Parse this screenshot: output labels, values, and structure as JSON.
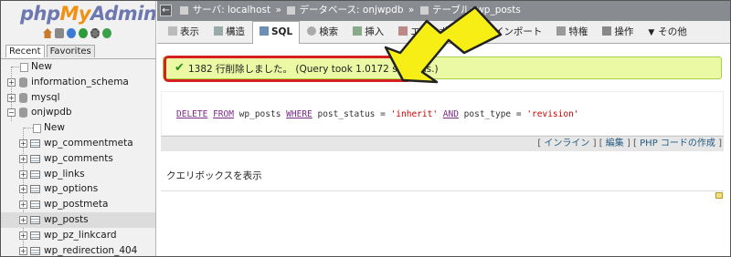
{
  "logo": {
    "php": "php",
    "my": "My",
    "admin": "Admin"
  },
  "quick_icons": [
    "home-icon",
    "exit-icon",
    "docs-icon",
    "help-icon",
    "settings-icon",
    "reload-icon"
  ],
  "nav_tabs": [
    {
      "label": "Recent"
    },
    {
      "label": "Favorites"
    }
  ],
  "tree": [
    {
      "label": "New"
    },
    {
      "label": "information_schema"
    },
    {
      "label": "mysql"
    },
    {
      "label": "onjwpdb"
    },
    {
      "label": "New"
    },
    {
      "label": "wp_commentmeta"
    },
    {
      "label": "wp_comments"
    },
    {
      "label": "wp_links"
    },
    {
      "label": "wp_options"
    },
    {
      "label": "wp_postmeta"
    },
    {
      "label": "wp_posts"
    },
    {
      "label": "wp_pz_linkcard"
    },
    {
      "label": "wp_redirection_404"
    }
  ],
  "breadcrumb": {
    "server": "サーバ: localhost",
    "sep1": "»",
    "database": "データベース: onjwpdb",
    "sep2": "»",
    "table": "テーブル: wp_posts"
  },
  "tabs": [
    {
      "label": "表示"
    },
    {
      "label": "構造"
    },
    {
      "label": "SQL"
    },
    {
      "label": "検索"
    },
    {
      "label": "挿入"
    },
    {
      "label": "エクスポート"
    },
    {
      "label": "インポート"
    },
    {
      "label": "特権"
    },
    {
      "label": "操作"
    },
    {
      "label": "その他"
    }
  ],
  "success": {
    "message": "1382 行削除しました。 (Query took 1.0172 seconds.)"
  },
  "sql": {
    "kw_delete": "DELETE",
    "kw_from": "FROM",
    "table": " wp_posts ",
    "kw_where": "WHERE",
    "cond1": " post_status = ",
    "val1": "'inherit'",
    "kw_and": "AND",
    "cond2": " post_type = ",
    "val2": "'revision'"
  },
  "links": {
    "open1": "[",
    "inline": "インライン",
    "sep1": "] [",
    "edit": "編集",
    "sep2": "] [",
    "php": "PHP コードの作成",
    "close": "]"
  },
  "query_box_label": "クエリボックスを表示",
  "colors": {
    "accent_red": "#d61f1f",
    "arrow_yellow": "#f7ee16",
    "success_bg": "#ebf8a4",
    "breadcrumb_bg": "#888b8f"
  }
}
